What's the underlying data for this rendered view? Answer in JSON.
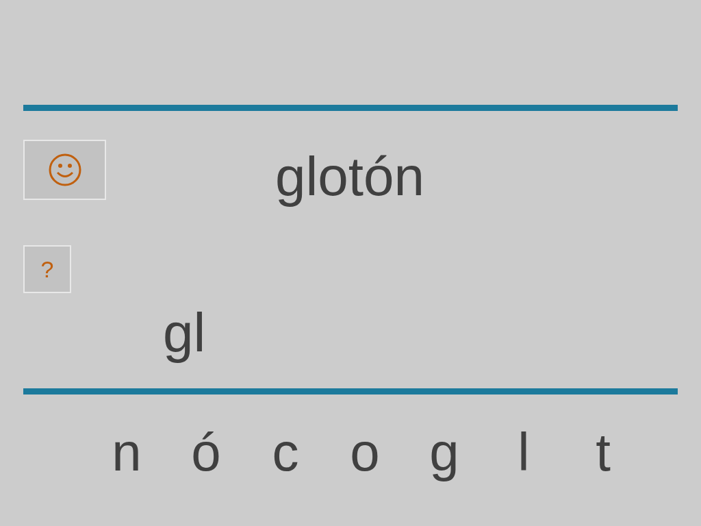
{
  "word": "glotón",
  "hint_button": {
    "label": "?"
  },
  "answer": {
    "value": "gl"
  },
  "letters": [
    "n",
    "ó",
    "c",
    "o",
    "g",
    "l",
    "t"
  ]
}
